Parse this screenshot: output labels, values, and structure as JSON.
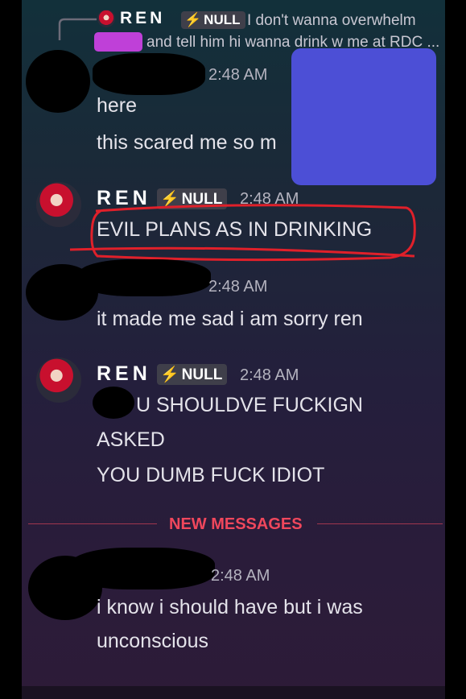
{
  "reply": {
    "author": "REN",
    "tag": "NULL",
    "snippet_line1": "I don't wanna overwhelm",
    "snippet_line2": "and tell him hi wanna drink w me at RDC ..."
  },
  "messages": [
    {
      "author": "",
      "timestamp": "2:48 AM",
      "lines": [
        "here",
        "this scared me so m"
      ]
    },
    {
      "author": "REN",
      "tag": "NULL",
      "timestamp": "2:48 AM",
      "lines": [
        "EVIL PLANS AS IN DRINKING"
      ]
    },
    {
      "author": "",
      "timestamp": "2:48 AM",
      "lines": [
        "it made me sad i am sorry ren"
      ]
    },
    {
      "author": "REN",
      "tag": "NULL",
      "timestamp": "2:48 AM",
      "lines": [
        "U SHOULDVE FUCKIGN",
        "ASKED",
        "YOU DUMB FUCK IDIOT"
      ]
    },
    {
      "author": "",
      "timestamp": "2:48 AM",
      "lines": [
        "i know i should have but i was",
        "unconscious"
      ]
    }
  ],
  "divider": {
    "label": "NEW MESSAGES",
    "color": "#f0475c"
  },
  "annotation_color": "#e0202a",
  "censor_colors": {
    "purple": "#bf40d8",
    "blue": "#4c4fd6",
    "black": "#000000"
  }
}
